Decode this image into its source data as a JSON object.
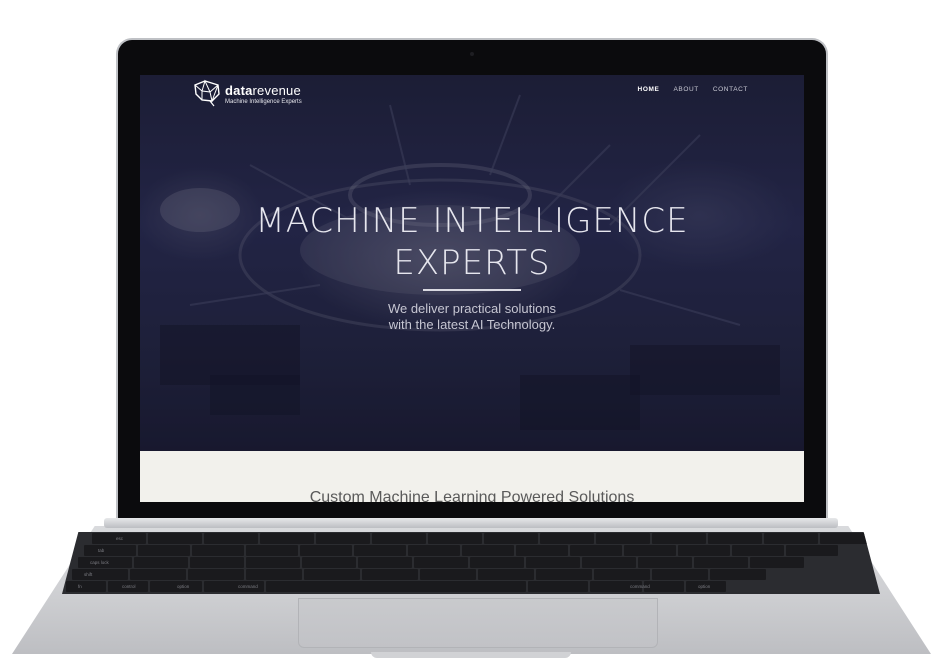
{
  "site": {
    "logo": {
      "name_bold": "data",
      "name_rest": "revenue",
      "tagline": "Machine Intelligence Experts"
    },
    "nav": [
      {
        "label": "HOME",
        "active": true
      },
      {
        "label": "ABOUT",
        "active": false
      },
      {
        "label": "CONTACT",
        "active": false
      }
    ],
    "hero": {
      "headline_line1": "MACHINE INTELLIGENCE",
      "headline_line2": "EXPERTS",
      "subtitle_line1": "We deliver practical solutions",
      "subtitle_line2": "with the latest AI Technology."
    },
    "section": {
      "title": "Custom Machine Learning Powered Solutions"
    }
  },
  "keyboard": {
    "labels": [
      "fn",
      "control",
      "option",
      "command",
      "command",
      "option",
      "shift",
      "caps lock",
      "tab",
      "esc"
    ]
  },
  "colors": {
    "hero_tint": "#1d1f33",
    "section_bg": "#f2f1ec",
    "bezel": "#0b0b0d",
    "chassis": "#cfd0d3"
  }
}
